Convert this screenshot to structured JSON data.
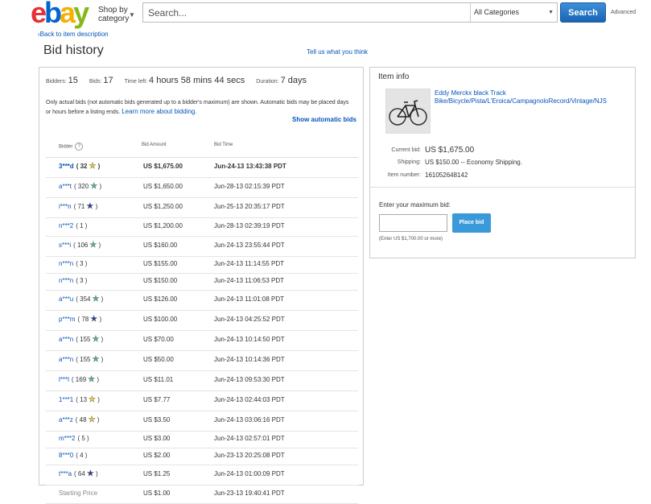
{
  "header": {
    "logo_letters": [
      "e",
      "b",
      "a",
      "y"
    ],
    "shop_by_line1": "Shop by",
    "shop_by_line2": "category",
    "search_placeholder": "Search...",
    "category_selected": "All Categories",
    "search_button": "Search",
    "advanced_link": "Advanced"
  },
  "nav": {
    "back_link": "Back to item description",
    "page_title": "Bid history",
    "feedback_link": "Tell us what you think"
  },
  "summary": {
    "bidders_label": "Bidders:",
    "bidders_value": "15",
    "bids_label": "Bids:",
    "bids_value": "17",
    "time_left_label": "Time left:",
    "time_left_value": "4 hours 58 mins 44 secs",
    "duration_label": "Duration:",
    "duration_value": "7 days",
    "note": "Only actual bids (not automatic bids generated up to a bidder's maximum) are shown. Automatic bids may be placed days or hours before a listing ends.",
    "learn_more": "Learn more about bidding.",
    "show_automatic": "Show automatic bids"
  },
  "bid_table": {
    "headers": {
      "bidder": "Bidder",
      "amount": "Bid Amount",
      "time": "Bid Time",
      "help": "?"
    },
    "rows": [
      {
        "bidder": "3***d",
        "feedback": "( 32",
        "star": "yellow",
        "amount": "US $1,675.00",
        "time": "Jun-24-13 13:43:38 PDT",
        "winning": true
      },
      {
        "bidder": "a***t",
        "feedback": "( 320",
        "star": "teal",
        "amount": "US $1,650.00",
        "time": "Jun-28-13 02:15:39 PDT"
      },
      {
        "bidder": "i***n",
        "feedback": "( 71",
        "star": "blue",
        "amount": "US $1,250.00",
        "time": "Jun-25-13 20:35:17 PDT"
      },
      {
        "bidder": "n***2",
        "feedback": "( 1 )",
        "star": "",
        "amount": "US $1,200.00",
        "time": "Jun-28-13 02:39:19 PDT"
      },
      {
        "bidder": "s***i",
        "feedback": "( 106",
        "star": "teal",
        "amount": "US $160.00",
        "time": "Jun-24-13 23:55:44 PDT"
      },
      {
        "bidder": "n***n",
        "feedback": "( 3 )",
        "star": "",
        "amount": "US $155.00",
        "time": "Jun-24-13 11:14:55 PDT"
      },
      {
        "bidder": "n***n",
        "feedback": "( 3 )",
        "star": "",
        "amount": "US $150.00",
        "time": "Jun-24-13 11:06:53 PDT"
      },
      {
        "bidder": "a***u",
        "feedback": "( 354",
        "star": "teal",
        "amount": "US $126.00",
        "time": "Jun-24-13 11:01:08 PDT"
      },
      {
        "bidder": "p***m",
        "feedback": "( 78",
        "star": "blue",
        "amount": "US $100.00",
        "time": "Jun-24-13 04:25:52 PDT"
      },
      {
        "bidder": "a***n",
        "feedback": "( 155",
        "star": "teal",
        "amount": "US $70.00",
        "time": "Jun-24-13 10:14:50 PDT"
      },
      {
        "bidder": "a***n",
        "feedback": "( 155",
        "star": "teal",
        "amount": "US $50.00",
        "time": "Jun-24-13 10:14:36 PDT"
      },
      {
        "bidder": "l***l",
        "feedback": "( 169",
        "star": "teal",
        "amount": "US $11.01",
        "time": "Jun-24-13 09:53:30 PDT"
      },
      {
        "bidder": "1***1",
        "feedback": "( 13",
        "star": "yellow",
        "amount": "US $7.77",
        "time": "Jun-24-13 02:44:03 PDT"
      },
      {
        "bidder": "a***z",
        "feedback": "( 48",
        "star": "yellow",
        "amount": "US $3.50",
        "time": "Jun-24-13 03:06:16 PDT"
      },
      {
        "bidder": "m***2",
        "feedback": "( 5 )",
        "star": "",
        "amount": "US $3.00",
        "time": "Jun-24-13 02:57:01 PDT"
      },
      {
        "bidder": "8***0",
        "feedback": "( 4 )",
        "star": "",
        "amount": "US $2.00",
        "time": "Jun-23-13 20:25:08 PDT"
      },
      {
        "bidder": "t***a",
        "feedback": "( 64",
        "star": "blue",
        "amount": "US $1.25",
        "time": "Jun-24-13 01:00:09 PDT"
      },
      {
        "bidder": "Starting Price",
        "feedback": "",
        "star": "",
        "amount": "US $1.00",
        "time": "Jun-23-13 19:40:41 PDT",
        "starting": true
      }
    ]
  },
  "item_info": {
    "heading": "Item info",
    "title": "Eddy Merckx black Track Bike/Bicycle/Pista/L'Eroica/CampagnoloRecord/Vintage/NJS",
    "current_bid_label": "Current bid:",
    "current_bid": "US $1,675.00",
    "shipping_label": "Shipping:",
    "shipping": "US $150.00 -- Economy Shipping.",
    "item_number_label": "Item number:",
    "item_number": "161052648142",
    "enter_max_label": "Enter your maximum bid:",
    "place_bid": "Place bid",
    "min_bid_note": "(Enter US $1,700.00 or more)"
  },
  "star_colors": {
    "yellow": "#f2d22e",
    "teal": "#4fb89a",
    "blue": "#2b3d9c"
  },
  "brand_colors": {
    "e": "#e53238",
    "b": "#0064d2",
    "a": "#f5af02",
    "y": "#86b817",
    "link": "#0654ba"
  }
}
